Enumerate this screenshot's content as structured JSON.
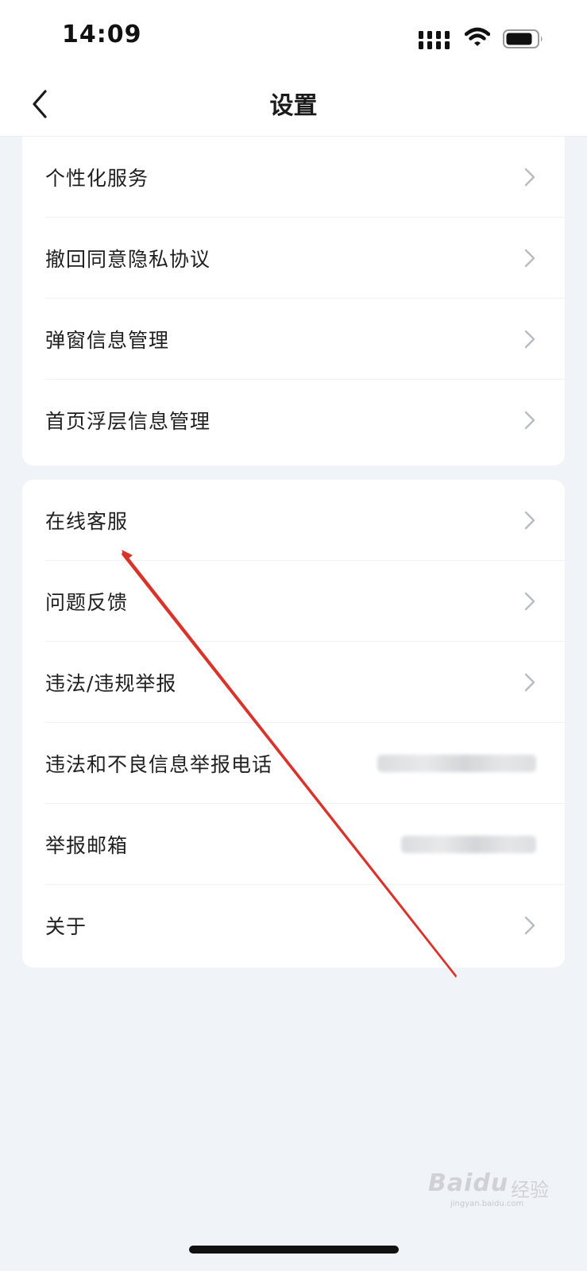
{
  "status_bar": {
    "time": "14:09",
    "icons": [
      "signal-icon",
      "wifi-icon",
      "battery-icon"
    ]
  },
  "nav": {
    "title": "设置",
    "back_icon": "chevron-left-icon"
  },
  "card1": {
    "items": [
      {
        "label": "个性化服务"
      },
      {
        "label": "撤回同意隐私协议"
      },
      {
        "label": "弹窗信息管理"
      },
      {
        "label": "首页浮层信息管理"
      }
    ]
  },
  "card2": {
    "items": [
      {
        "label": "在线客服"
      },
      {
        "label": "问题反馈"
      },
      {
        "label": "违法/违规举报"
      },
      {
        "label": "违法和不良信息举报电话"
      },
      {
        "label": "举报邮箱"
      },
      {
        "label": "关于"
      }
    ]
  },
  "watermark": {
    "brand": "Baidu",
    "sub": "经验",
    "url": "jingyan.baidu.com"
  },
  "colors": {
    "background": "#f0f3f7",
    "card": "#ffffff",
    "chevron": "#b8bcc2",
    "annotation_arrow": "#d9332b"
  }
}
